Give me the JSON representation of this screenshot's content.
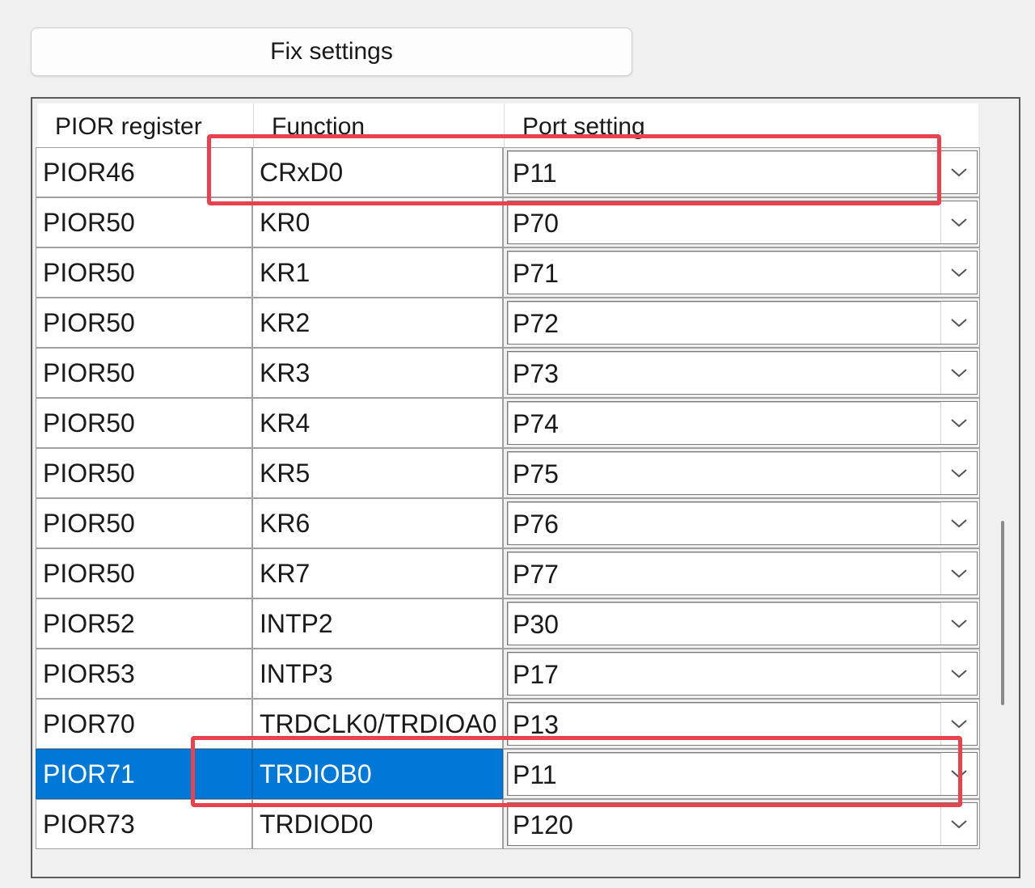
{
  "toolbar": {
    "fix_settings_label": "Fix settings"
  },
  "grid": {
    "headers": [
      "PIOR register",
      "Function",
      "Port setting"
    ],
    "rows": [
      {
        "register": "PIOR46",
        "function": "CRxD0",
        "port": "P11"
      },
      {
        "register": "PIOR50",
        "function": "KR0",
        "port": "P70"
      },
      {
        "register": "PIOR50",
        "function": "KR1",
        "port": "P71"
      },
      {
        "register": "PIOR50",
        "function": "KR2",
        "port": "P72"
      },
      {
        "register": "PIOR50",
        "function": "KR3",
        "port": "P73"
      },
      {
        "register": "PIOR50",
        "function": "KR4",
        "port": "P74"
      },
      {
        "register": "PIOR50",
        "function": "KR5",
        "port": "P75"
      },
      {
        "register": "PIOR50",
        "function": "KR6",
        "port": "P76"
      },
      {
        "register": "PIOR50",
        "function": "KR7",
        "port": "P77"
      },
      {
        "register": "PIOR52",
        "function": "INTP2",
        "port": "P30"
      },
      {
        "register": "PIOR53",
        "function": "INTP3",
        "port": "P17"
      },
      {
        "register": "PIOR70",
        "function": "TRDCLK0/TRDIOA0",
        "port": "P13"
      },
      {
        "register": "PIOR71",
        "function": "TRDIOB0",
        "port": "P11",
        "selected": true
      },
      {
        "register": "PIOR73",
        "function": "TRDIOD0",
        "port": "P120"
      }
    ],
    "highlighted_rows": [
      0,
      12
    ],
    "scroll_position_fraction": 0.75
  },
  "icons": {
    "dropdown": "chevron-down-icon"
  },
  "colors": {
    "selection": "#0078d7",
    "annotation": "#e8424f"
  }
}
